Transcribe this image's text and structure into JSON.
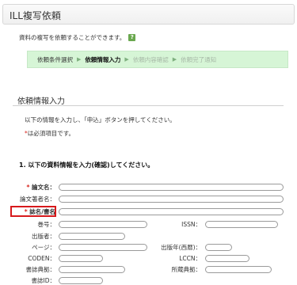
{
  "page": {
    "title": "ILL複写依頼",
    "intro": "資料の複写を依頼することができます。",
    "help_icon": "help-icon"
  },
  "steps": [
    {
      "label": "依頼条件選択",
      "state": "done"
    },
    {
      "label": "依頼情報入力",
      "state": "current"
    },
    {
      "label": "依頼内容確認",
      "state": "todo"
    },
    {
      "label": "依頼完了通知",
      "state": "todo"
    }
  ],
  "step_arrow": "▶",
  "section": {
    "title": "依頼情報入力",
    "instruction": "以下の情報を入力し、「申込」ボタンを押してください。",
    "required_mark": "*",
    "required_note": "は必須項目です。"
  },
  "form": {
    "heading": "1. 以下の資料情報を入力(確認)してください。",
    "fields": {
      "article_title": {
        "label": "論文名：",
        "required": true,
        "value": ""
      },
      "article_author": {
        "label": "論文著者名：",
        "required": false,
        "value": ""
      },
      "journal_title": {
        "label": "誌名/書名",
        "required": true,
        "value": ""
      },
      "volume": {
        "label": "巻号：",
        "value": ""
      },
      "issn": {
        "label": "ISSN：",
        "value": ""
      },
      "publisher": {
        "label": "出版者：",
        "value": ""
      },
      "pages": {
        "label": "ページ：",
        "value": ""
      },
      "pub_year": {
        "label": "出版年(西暦)：",
        "value": ""
      },
      "coden": {
        "label": "CODEN：",
        "value": ""
      },
      "lccn": {
        "label": "LCCN：",
        "value": ""
      },
      "bib_holding": {
        "label": "書誌典拠：",
        "value": ""
      },
      "holding_lib": {
        "label": "所蔵典拠：",
        "value": ""
      },
      "bib_id": {
        "label": "書誌ID：",
        "value": ""
      }
    }
  },
  "colors": {
    "required": "#d9271f",
    "step_bar": "#d6f5d6",
    "highlight": "#d7191c"
  }
}
